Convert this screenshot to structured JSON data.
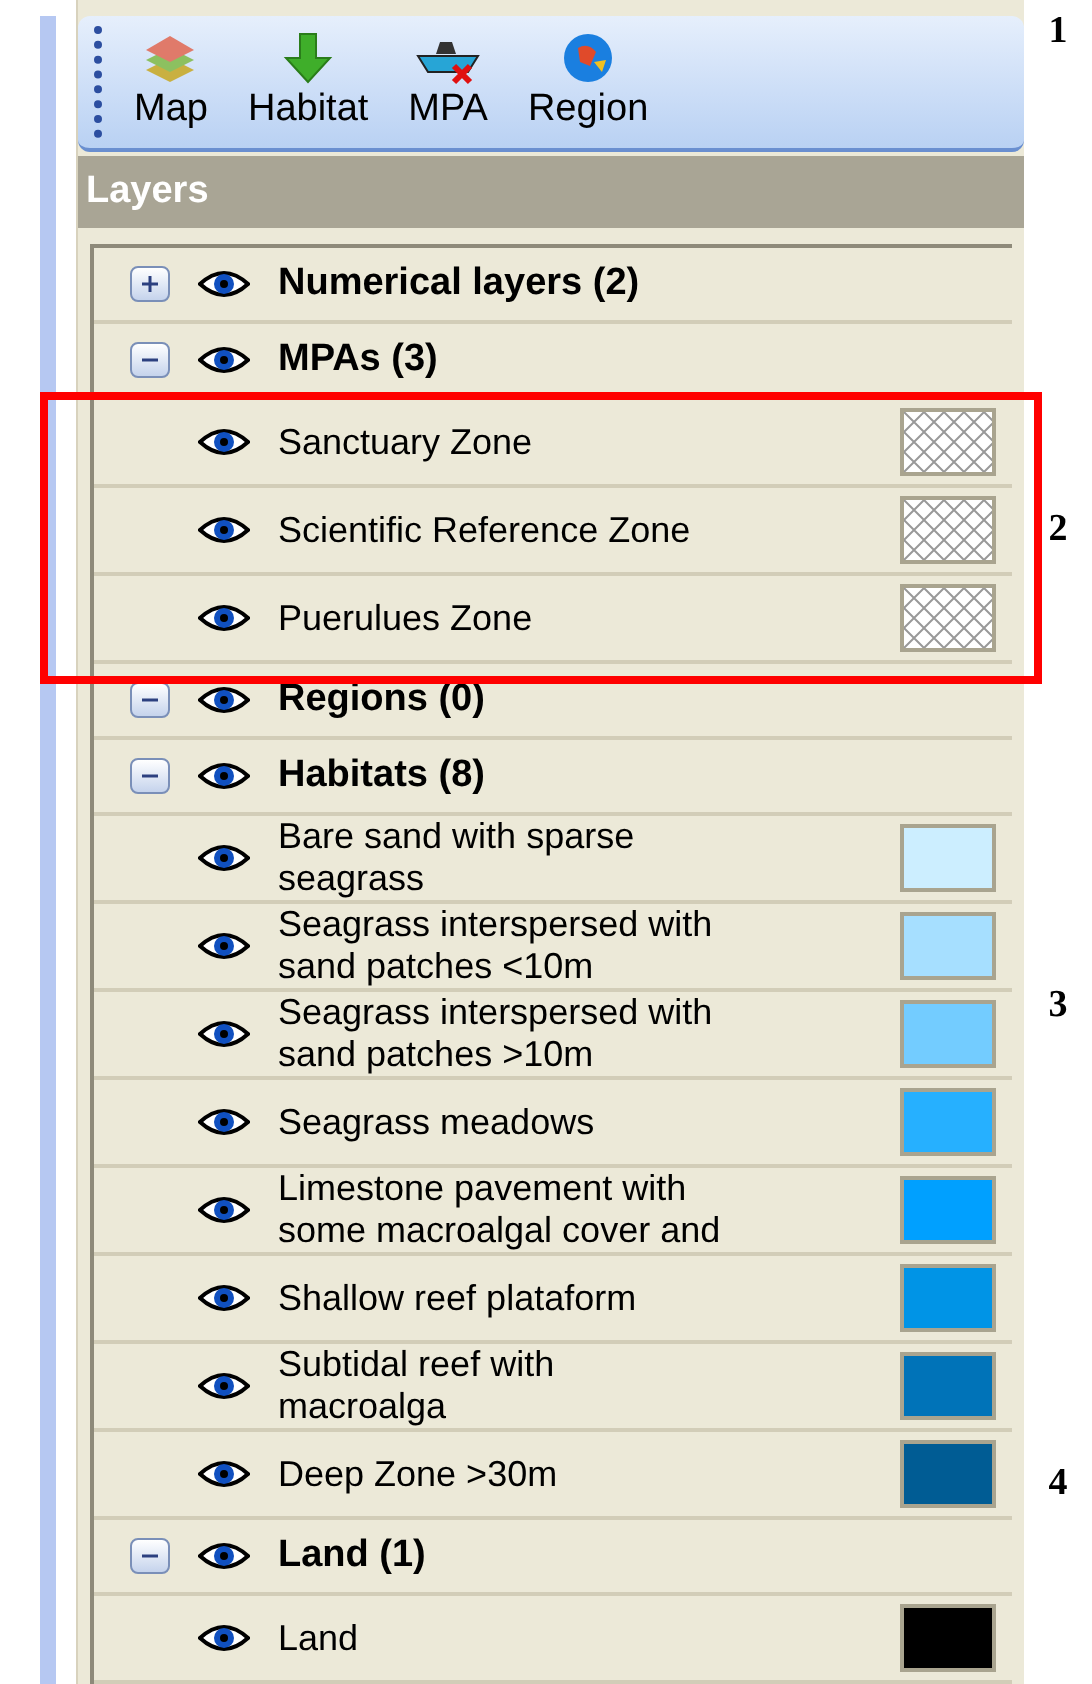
{
  "toolbar": [
    {
      "label": "Map",
      "kind": "layers"
    },
    {
      "label": "Habitat",
      "kind": "arrow"
    },
    {
      "label": "MPA",
      "kind": "boat"
    },
    {
      "label": "Region",
      "kind": "globe"
    }
  ],
  "panel": {
    "title": "Layers"
  },
  "groups": [
    {
      "label": "Numerical layers (2)",
      "expanded": false
    },
    {
      "label": "MPAs (3)",
      "expanded": true,
      "items": [
        {
          "label": "Sanctuary Zone",
          "kind": "hatch"
        },
        {
          "label": "Scientific Reference Zone",
          "kind": "hatch"
        },
        {
          "label": "Puerulues Zone",
          "kind": "hatch"
        }
      ]
    },
    {
      "label": "Regions (0)",
      "expanded": true
    },
    {
      "label": "Habitats (8)",
      "expanded": true,
      "items": [
        {
          "label": "Bare sand with sparse\nseagrass",
          "kind": "solid",
          "color": "#cceeff"
        },
        {
          "label": "Seagrass interspersed with\nsand patches <10m",
          "kind": "solid",
          "color": "#a6dfff"
        },
        {
          "label": "Seagrass interspersed with\nsand patches >10m",
          "kind": "solid",
          "color": "#73ccff"
        },
        {
          "label": "Seagrass meadows",
          "kind": "solid",
          "color": "#26b0ff"
        },
        {
          "label": "Limestone pavement with\nsome macroalgal cover and",
          "kind": "solid",
          "color": "#00a0ff"
        },
        {
          "label": "Shallow reef plataform",
          "kind": "solid",
          "color": "#0094e6"
        },
        {
          "label": "Subtidal reef with\nmacroalga",
          "kind": "solid",
          "color": "#0073b8"
        },
        {
          "label": "Deep Zone >30m",
          "kind": "solid",
          "color": "#005c94"
        }
      ]
    },
    {
      "label": "Land (1)",
      "expanded": true,
      "items": [
        {
          "label": "Land",
          "kind": "solid",
          "color": "#000000"
        }
      ]
    }
  ],
  "annotations": [
    "1",
    "2",
    "3",
    "4"
  ]
}
